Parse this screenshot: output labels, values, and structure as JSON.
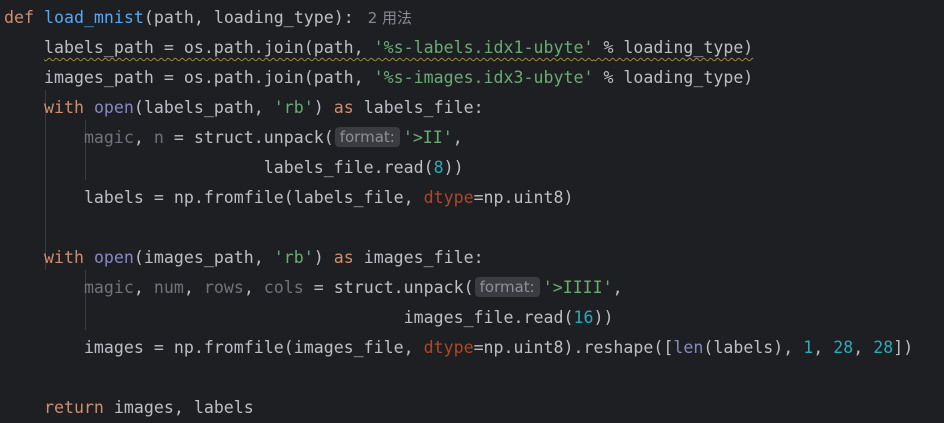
{
  "function": {
    "def_keyword": "def",
    "name": "load_mnist",
    "signature_rest": "(path, loading_type):",
    "usages_hint": "2 用法"
  },
  "code": {
    "labels_path_assign": "labels_path = os.path.join(path, ",
    "labels_path_str": "'%s-labels.idx1-ubyte'",
    "labels_path_tail": " % loading_type)",
    "images_path_assign": "images_path = os.path.join(path, ",
    "images_path_str": "'%s-images.idx3-ubyte'",
    "images_path_tail": " % loading_type)",
    "with_kw": "with",
    "open_fn": "open",
    "labels_open_args": "(labels_path, ",
    "rb_str": "'rb'",
    "as_kw": "as",
    "labels_file_tail": " labels_file:",
    "magic": "magic",
    "comma_sep": ", ",
    "n_var": "n",
    "unpack_call": " = struct.unpack(",
    "inlay_format": "format:",
    "fmt_ii": "'>II'",
    "trailing_comma": ",",
    "labels_read_prefix": "labels_file.read(",
    "num_8": "8",
    "close_2": "))",
    "labels_assign": "labels = np.fromfile(labels_file, ",
    "dtype_kw": "dtype",
    "uint8_tail": "=np.uint8)",
    "images_open_args": "(images_path, ",
    "images_file_tail": " images_file:",
    "num_var": "num",
    "rows_var": "rows",
    "cols_var": "cols",
    "fmt_iiii": "'>IIII'",
    "images_read_prefix": "images_file.read(",
    "num_16": "16",
    "images_assign": "images = np.fromfile(images_file, ",
    "reshape_mid": "=np.uint8).reshape([",
    "len_fn": "len",
    "len_args": "(labels), ",
    "num_1": "1",
    "num_28": "28",
    "close_reshape": "])",
    "return_kw": "return",
    "return_tail": " images, labels"
  },
  "colors": {
    "background": "#1e1f22",
    "keyword": "#cf8e6d",
    "function": "#56a8f5",
    "string": "#6aab73",
    "number": "#2aacb8",
    "builtin": "#8888c6",
    "parameter": "#aa4926",
    "unused": "#6f737a",
    "text": "#bcbec4"
  }
}
